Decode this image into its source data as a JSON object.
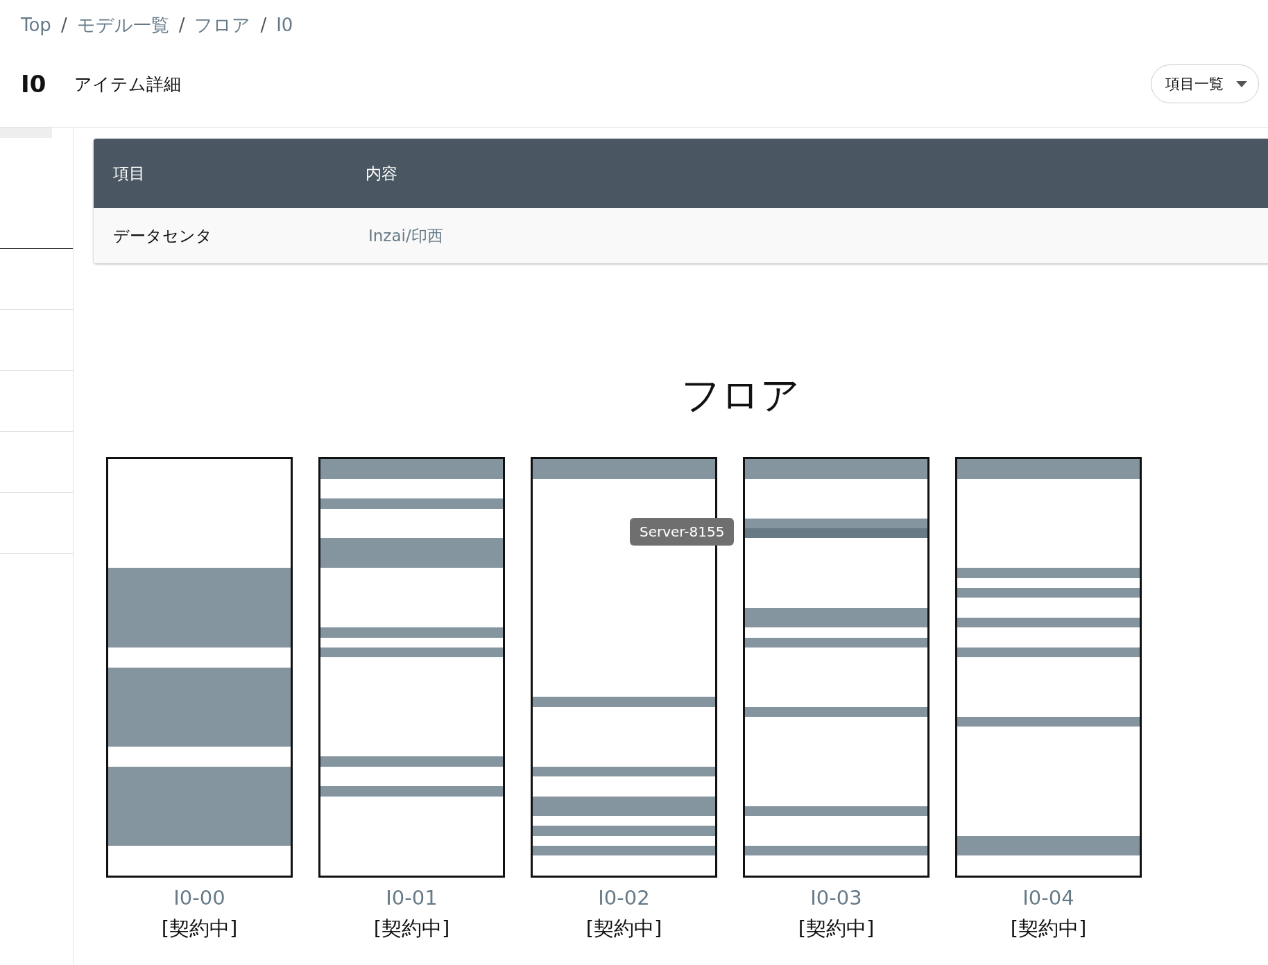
{
  "breadcrumb": [
    "Top",
    "モデル一覧",
    "フロア",
    "I0"
  ],
  "breadcrumb_separator": "/",
  "header": {
    "title": "I0",
    "subtitle": "アイテム詳細",
    "menu_button": "項目一覧"
  },
  "table": {
    "columns": [
      "項目",
      "内容"
    ],
    "rows": [
      {
        "label": "データセンタ",
        "value": "Inzai/印西"
      }
    ]
  },
  "floor": {
    "title": "フロア",
    "racks": [
      {
        "name": "I0-00",
        "status": "[契約中]",
        "units": [
          {
            "kind": "empty"
          },
          {
            "kind": "empty"
          },
          {
            "kind": "empty"
          },
          {
            "kind": "empty"
          },
          {
            "kind": "empty"
          },
          {
            "kind": "empty"
          },
          {
            "kind": "empty"
          },
          {
            "kind": "empty"
          },
          {
            "kind": "empty"
          },
          {
            "kind": "empty"
          },
          {
            "kind": "empty"
          },
          {
            "kind": "server"
          },
          {
            "kind": "server"
          },
          {
            "kind": "server"
          },
          {
            "kind": "server"
          },
          {
            "kind": "server"
          },
          {
            "kind": "server"
          },
          {
            "kind": "server"
          },
          {
            "kind": "server"
          },
          {
            "kind": "empty"
          },
          {
            "kind": "empty"
          },
          {
            "kind": "server"
          },
          {
            "kind": "server"
          },
          {
            "kind": "server"
          },
          {
            "kind": "server"
          },
          {
            "kind": "server"
          },
          {
            "kind": "server"
          },
          {
            "kind": "server"
          },
          {
            "kind": "server"
          },
          {
            "kind": "empty"
          },
          {
            "kind": "empty"
          },
          {
            "kind": "server"
          },
          {
            "kind": "server"
          },
          {
            "kind": "server"
          },
          {
            "kind": "server"
          },
          {
            "kind": "server"
          },
          {
            "kind": "server"
          },
          {
            "kind": "server"
          },
          {
            "kind": "server"
          },
          {
            "kind": "empty"
          },
          {
            "kind": "empty"
          },
          {
            "kind": "empty"
          }
        ]
      },
      {
        "name": "I0-01",
        "status": "[契約中]",
        "units": [
          {
            "kind": "server"
          },
          {
            "kind": "server"
          },
          {
            "kind": "empty"
          },
          {
            "kind": "empty"
          },
          {
            "kind": "server"
          },
          {
            "kind": "empty"
          },
          {
            "kind": "empty"
          },
          {
            "kind": "empty"
          },
          {
            "kind": "server"
          },
          {
            "kind": "server"
          },
          {
            "kind": "server"
          },
          {
            "kind": "empty"
          },
          {
            "kind": "empty"
          },
          {
            "kind": "empty"
          },
          {
            "kind": "empty"
          },
          {
            "kind": "empty"
          },
          {
            "kind": "empty"
          },
          {
            "kind": "server"
          },
          {
            "kind": "empty"
          },
          {
            "kind": "server"
          },
          {
            "kind": "empty"
          },
          {
            "kind": "empty"
          },
          {
            "kind": "empty"
          },
          {
            "kind": "empty"
          },
          {
            "kind": "empty"
          },
          {
            "kind": "empty"
          },
          {
            "kind": "empty"
          },
          {
            "kind": "empty"
          },
          {
            "kind": "empty"
          },
          {
            "kind": "empty"
          },
          {
            "kind": "server"
          },
          {
            "kind": "empty"
          },
          {
            "kind": "empty"
          },
          {
            "kind": "server"
          },
          {
            "kind": "empty"
          },
          {
            "kind": "empty"
          },
          {
            "kind": "empty"
          },
          {
            "kind": "empty"
          },
          {
            "kind": "empty"
          },
          {
            "kind": "empty"
          },
          {
            "kind": "empty"
          },
          {
            "kind": "empty"
          }
        ]
      },
      {
        "name": "I0-02",
        "status": "[契約中]",
        "units": [
          {
            "kind": "server"
          },
          {
            "kind": "server"
          },
          {
            "kind": "empty"
          },
          {
            "kind": "empty"
          },
          {
            "kind": "empty"
          },
          {
            "kind": "empty"
          },
          {
            "kind": "empty"
          },
          {
            "kind": "empty"
          },
          {
            "kind": "empty"
          },
          {
            "kind": "empty"
          },
          {
            "kind": "empty"
          },
          {
            "kind": "empty"
          },
          {
            "kind": "empty"
          },
          {
            "kind": "empty"
          },
          {
            "kind": "empty"
          },
          {
            "kind": "empty"
          },
          {
            "kind": "empty"
          },
          {
            "kind": "empty"
          },
          {
            "kind": "empty"
          },
          {
            "kind": "empty"
          },
          {
            "kind": "empty"
          },
          {
            "kind": "empty"
          },
          {
            "kind": "empty"
          },
          {
            "kind": "empty"
          },
          {
            "kind": "server"
          },
          {
            "kind": "empty"
          },
          {
            "kind": "empty"
          },
          {
            "kind": "empty"
          },
          {
            "kind": "empty"
          },
          {
            "kind": "empty"
          },
          {
            "kind": "empty"
          },
          {
            "kind": "server"
          },
          {
            "kind": "empty"
          },
          {
            "kind": "empty"
          },
          {
            "kind": "server"
          },
          {
            "kind": "server"
          },
          {
            "kind": "empty"
          },
          {
            "kind": "server"
          },
          {
            "kind": "empty"
          },
          {
            "kind": "server"
          },
          {
            "kind": "empty"
          },
          {
            "kind": "empty"
          }
        ]
      },
      {
        "name": "I0-03",
        "status": "[契約中]",
        "units": [
          {
            "kind": "server"
          },
          {
            "kind": "server"
          },
          {
            "kind": "empty"
          },
          {
            "kind": "empty"
          },
          {
            "kind": "empty"
          },
          {
            "kind": "empty"
          },
          {
            "kind": "server"
          },
          {
            "kind": "hovered"
          },
          {
            "kind": "empty"
          },
          {
            "kind": "empty"
          },
          {
            "kind": "empty"
          },
          {
            "kind": "empty"
          },
          {
            "kind": "empty"
          },
          {
            "kind": "empty"
          },
          {
            "kind": "empty"
          },
          {
            "kind": "server"
          },
          {
            "kind": "server"
          },
          {
            "kind": "empty"
          },
          {
            "kind": "server"
          },
          {
            "kind": "empty"
          },
          {
            "kind": "empty"
          },
          {
            "kind": "empty"
          },
          {
            "kind": "empty"
          },
          {
            "kind": "empty"
          },
          {
            "kind": "empty"
          },
          {
            "kind": "server"
          },
          {
            "kind": "empty"
          },
          {
            "kind": "empty"
          },
          {
            "kind": "empty"
          },
          {
            "kind": "empty"
          },
          {
            "kind": "empty"
          },
          {
            "kind": "empty"
          },
          {
            "kind": "empty"
          },
          {
            "kind": "empty"
          },
          {
            "kind": "empty"
          },
          {
            "kind": "server"
          },
          {
            "kind": "empty"
          },
          {
            "kind": "empty"
          },
          {
            "kind": "empty"
          },
          {
            "kind": "server"
          },
          {
            "kind": "empty"
          },
          {
            "kind": "empty"
          }
        ]
      },
      {
        "name": "I0-04",
        "status": "[契約中]",
        "units": [
          {
            "kind": "server"
          },
          {
            "kind": "server"
          },
          {
            "kind": "empty"
          },
          {
            "kind": "empty"
          },
          {
            "kind": "empty"
          },
          {
            "kind": "empty"
          },
          {
            "kind": "empty"
          },
          {
            "kind": "empty"
          },
          {
            "kind": "empty"
          },
          {
            "kind": "empty"
          },
          {
            "kind": "empty"
          },
          {
            "kind": "server"
          },
          {
            "kind": "empty"
          },
          {
            "kind": "server"
          },
          {
            "kind": "empty"
          },
          {
            "kind": "empty"
          },
          {
            "kind": "server"
          },
          {
            "kind": "empty"
          },
          {
            "kind": "empty"
          },
          {
            "kind": "server"
          },
          {
            "kind": "empty"
          },
          {
            "kind": "empty"
          },
          {
            "kind": "empty"
          },
          {
            "kind": "empty"
          },
          {
            "kind": "empty"
          },
          {
            "kind": "empty"
          },
          {
            "kind": "server"
          },
          {
            "kind": "empty"
          },
          {
            "kind": "empty"
          },
          {
            "kind": "empty"
          },
          {
            "kind": "empty"
          },
          {
            "kind": "empty"
          },
          {
            "kind": "empty"
          },
          {
            "kind": "empty"
          },
          {
            "kind": "empty"
          },
          {
            "kind": "empty"
          },
          {
            "kind": "empty"
          },
          {
            "kind": "empty"
          },
          {
            "kind": "server"
          },
          {
            "kind": "server"
          },
          {
            "kind": "empty"
          },
          {
            "kind": "empty"
          }
        ]
      }
    ],
    "tooltip": {
      "text": "Server-8155"
    }
  }
}
